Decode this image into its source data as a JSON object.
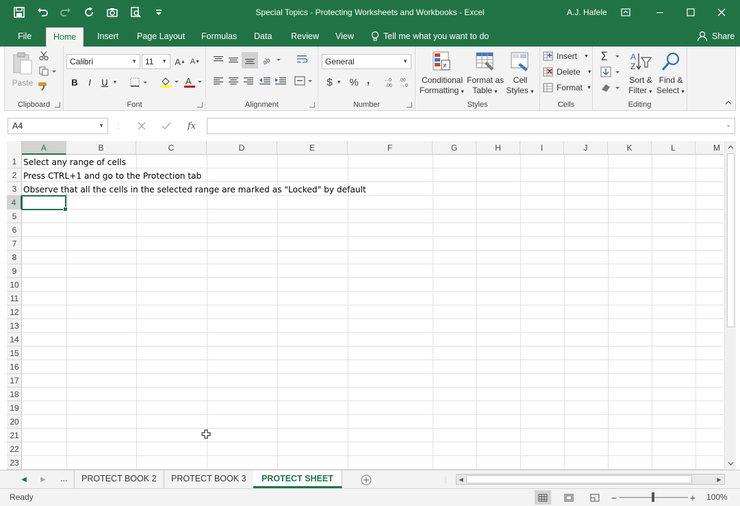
{
  "window": {
    "title": "Special Topics - Protecting Worksheets and Workbooks  -  Excel",
    "user": "A.J. Hafele"
  },
  "tabs": [
    "File",
    "Home",
    "Insert",
    "Page Layout",
    "Formulas",
    "Data",
    "Review",
    "View"
  ],
  "tell_me": "Tell me what you want to do",
  "share": "Share",
  "ribbon": {
    "clipboard": {
      "label": "Clipboard",
      "paste": "Paste"
    },
    "font": {
      "label": "Font",
      "name": "Calibri",
      "size": "11",
      "bold": "B",
      "italic": "I",
      "underline": "U"
    },
    "alignment": {
      "label": "Alignment"
    },
    "number": {
      "label": "Number",
      "format": "General",
      "currency": "$",
      "percent": "%",
      "comma": ","
    },
    "styles": {
      "label": "Styles",
      "conditional_1": "Conditional",
      "conditional_2": "Formatting",
      "format_table_1": "Format as",
      "format_table_2": "Table",
      "cell_styles_1": "Cell",
      "cell_styles_2": "Styles"
    },
    "cells": {
      "label": "Cells",
      "insert": "Insert",
      "delete": "Delete",
      "format": "Format"
    },
    "editing": {
      "label": "Editing",
      "sort_1": "Sort &",
      "sort_2": "Filter",
      "find_1": "Find &",
      "find_2": "Select"
    }
  },
  "formula_bar": {
    "name_box": "A4",
    "fx": "fx",
    "content": ""
  },
  "columns": [
    "A",
    "B",
    "C",
    "D",
    "E",
    "F",
    "G",
    "H",
    "I",
    "J",
    "K",
    "L",
    "M"
  ],
  "rows": [
    "1",
    "2",
    "3",
    "4",
    "5",
    "6",
    "7",
    "8",
    "9",
    "10",
    "11",
    "12",
    "13",
    "14",
    "15",
    "16",
    "17",
    "18",
    "19",
    "20",
    "21",
    "22",
    "23"
  ],
  "selected_cell": "A4",
  "cells": {
    "a1": "Select any range of cells",
    "a2": "Press CTRL+1 and go to the Protection tab",
    "a3": "Observe that all the cells in the selected range are marked as \"Locked\" by default"
  },
  "sheet_tabs": {
    "ellipsis": "...",
    "tab1": "PROTECT BOOK 2",
    "tab2": "PROTECT BOOK 3",
    "tab3": "PROTECT SHEET",
    "active": "PROTECT SHEET"
  },
  "status": {
    "ready": "Ready",
    "zoom": "100%"
  },
  "colors": {
    "accent": "#217346",
    "ribbon_bg": "#f3f3f3",
    "gridline": "#e1e1e1"
  }
}
